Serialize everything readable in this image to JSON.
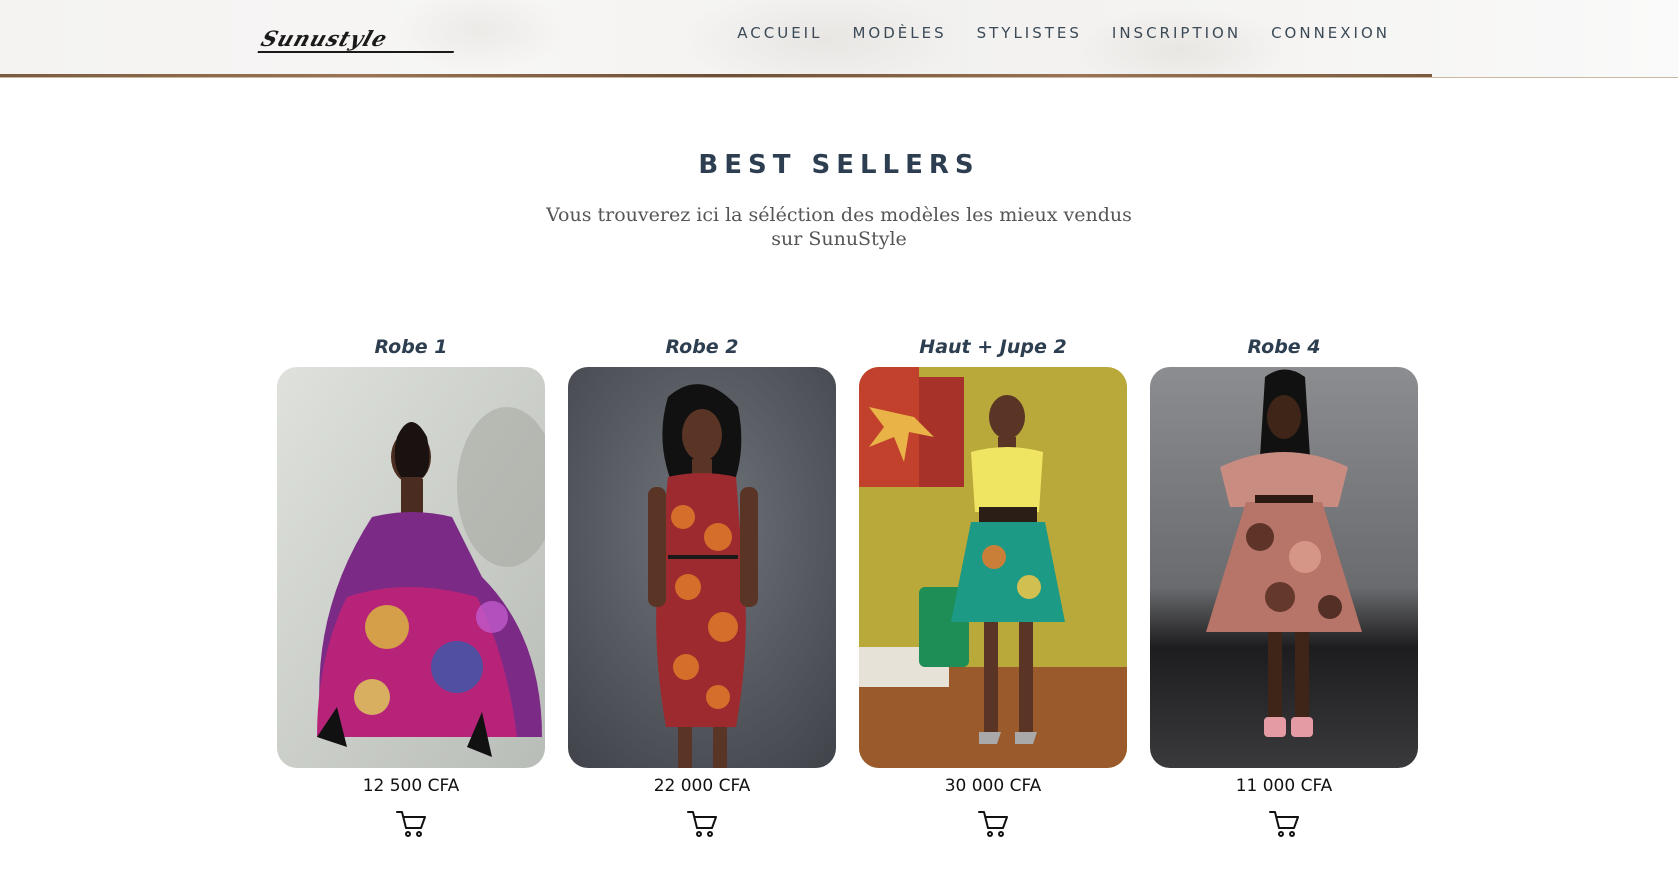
{
  "header": {
    "logo_text": "Sunustyle",
    "nav": [
      "ACCUEIL",
      "MODÈLES",
      "STYLISTES",
      "INSCRIPTION",
      "CONNEXION"
    ]
  },
  "section": {
    "title": "BEST SELLERS",
    "subtitle": "Vous trouverez ici la séléction des modèles les mieux vendus sur SunuStyle"
  },
  "products": [
    {
      "name": "Robe 1",
      "price": "12 500 CFA",
      "icon": "cart-icon"
    },
    {
      "name": "Robe 2",
      "price": "22 000 CFA",
      "icon": "cart-icon"
    },
    {
      "name": "Haut + Jupe 2",
      "price": "30 000 CFA",
      "icon": "cart-icon"
    },
    {
      "name": "Robe 4",
      "price": "11 000 CFA",
      "icon": "cart-icon"
    }
  ],
  "colors": {
    "heading": "#2c3e50",
    "nav": "#3c4a57",
    "header_border": "#7a5a3f"
  }
}
